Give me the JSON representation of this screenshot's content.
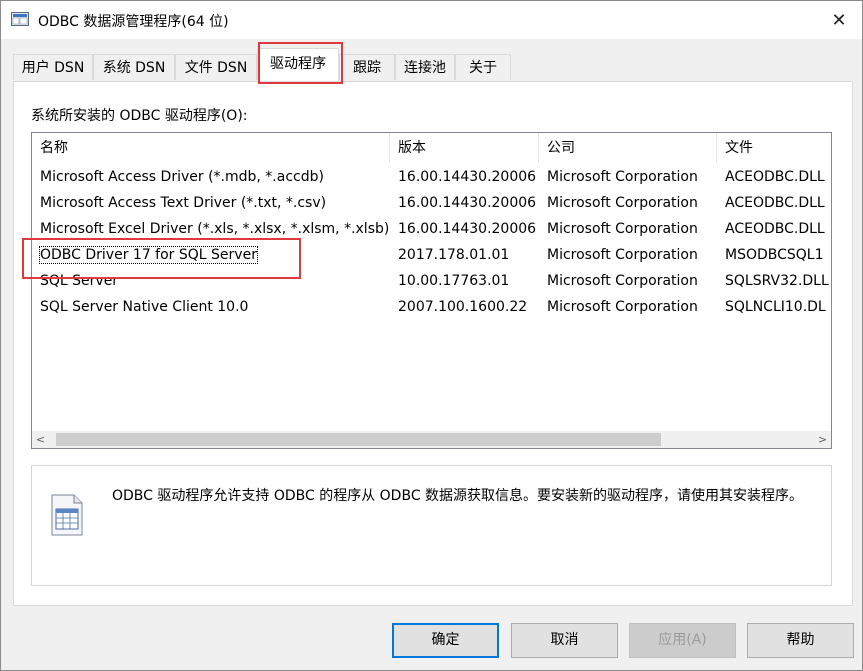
{
  "window": {
    "title": "ODBC 数据源管理程序(64 位)",
    "close_glyph": "✕"
  },
  "tabs": [
    {
      "label": "用户 DSN"
    },
    {
      "label": "系统 DSN"
    },
    {
      "label": "文件 DSN"
    },
    {
      "label": "驱动程序",
      "active": true
    },
    {
      "label": "跟踪"
    },
    {
      "label": "连接池"
    },
    {
      "label": "关于"
    }
  ],
  "panel": {
    "label": "系统所安装的 ODBC 驱动程序(O):"
  },
  "drivers": {
    "columns": [
      "名称",
      "版本",
      "公司",
      "文件"
    ],
    "rows": [
      [
        "Microsoft Access Driver (*.mdb, *.accdb)",
        "16.00.14430.20006",
        "Microsoft Corporation",
        "ACEODBC.DLL"
      ],
      [
        "Microsoft Access Text Driver (*.txt, *.csv)",
        "16.00.14430.20006",
        "Microsoft Corporation",
        "ACEODBC.DLL"
      ],
      [
        "Microsoft Excel Driver (*.xls, *.xlsx, *.xlsm, *.xlsb)",
        "16.00.14430.20006",
        "Microsoft Corporation",
        "ACEODBC.DLL"
      ],
      [
        "ODBC Driver 17 for SQL Server",
        "2017.178.01.01",
        "Microsoft Corporation",
        "MSODBCSQL1"
      ],
      [
        "SQL Server",
        "10.00.17763.01",
        "Microsoft Corporation",
        "SQLSRV32.DLL"
      ],
      [
        "SQL Server Native Client 10.0",
        "2007.100.1600.22",
        "Microsoft Corporation",
        "SQLNCLI10.DL"
      ]
    ],
    "focused_row": 3
  },
  "scrollbar": {
    "left_arrow": "<",
    "right_arrow": ">"
  },
  "info": {
    "icon": "document-table-icon",
    "text": "ODBC 驱动程序允许支持 ODBC 的程序从 ODBC 数据源获取信息。要安装新的驱动程序，请使用其安装程序。"
  },
  "buttons": {
    "ok": "确定",
    "cancel": "取消",
    "apply": "应用(A)",
    "help": "帮助"
  },
  "colors": {
    "highlight_box": "#e0393e",
    "default_button_border": "#0078d7"
  }
}
